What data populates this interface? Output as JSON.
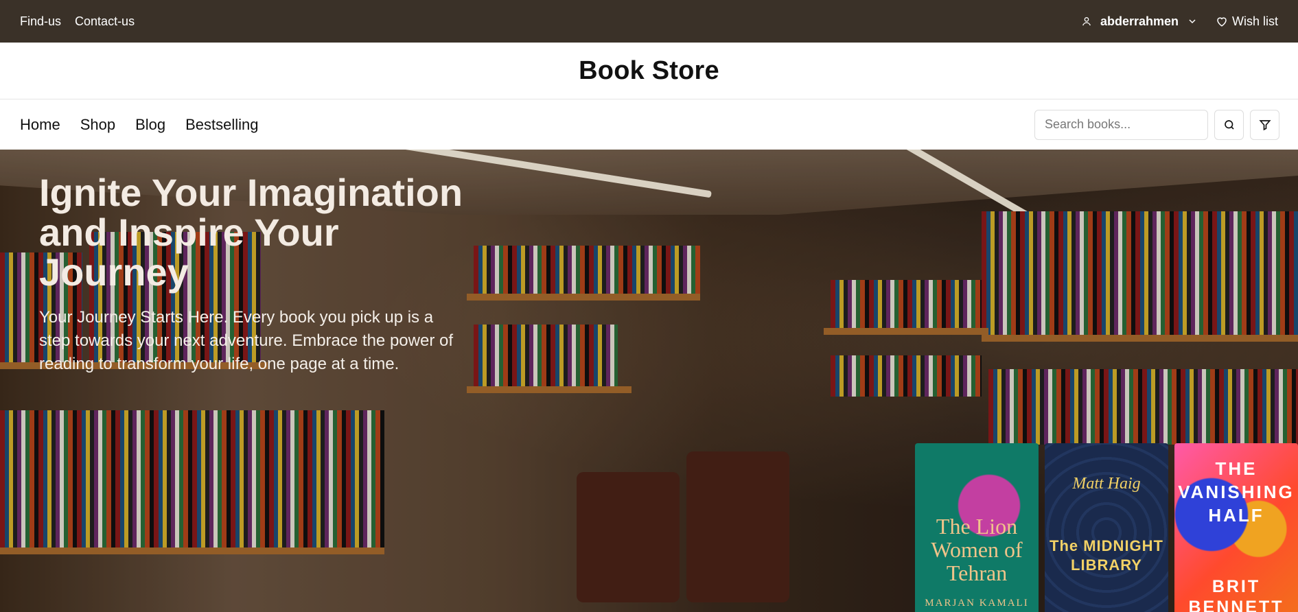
{
  "topbar": {
    "links": [
      "Find-us",
      "Contact-us"
    ],
    "username": "abderrahmen",
    "wishlist_label": "Wish list"
  },
  "brand": {
    "title": "Book Store"
  },
  "nav": {
    "links": [
      "Home",
      "Shop",
      "Blog",
      "Bestselling"
    ],
    "search_placeholder": "Search books..."
  },
  "hero": {
    "heading": "Ignite Your Imagination and Inspire Your Journey",
    "subtext": "Your Journey Starts Here. Every book you pick up is a step towards your next adventure. Embrace the power of reading to transform your life, one page at a time."
  },
  "covers": [
    {
      "title": "The Lion Women of Tehran",
      "author": "MARJAN KAMALI"
    },
    {
      "title": "The MIDNIGHT LIBRARY",
      "author": "Matt Haig"
    },
    {
      "title": "THE VANISHING HALF",
      "author": "BRIT BENNETT"
    }
  ],
  "colors": {
    "topbar_bg": "#3a3128",
    "text": "#111111",
    "border": "#dddddd"
  },
  "icons": [
    "user-icon",
    "chevron-down-icon",
    "heart-icon",
    "search-icon",
    "filter-icon"
  ]
}
